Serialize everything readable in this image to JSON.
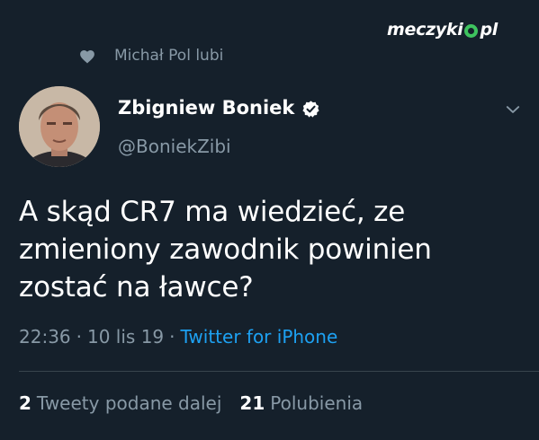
{
  "watermark": {
    "part1": "meczyki",
    "part2": "pl"
  },
  "social_context": {
    "icon": "heart-icon",
    "text": "Michał Pol lubi"
  },
  "author": {
    "name": "Zbigniew Boniek",
    "handle": "@BoniekZibi",
    "verified": true
  },
  "tweet": {
    "lines": [
      "A skąd CR7 ma wiedzieć, ze",
      "zmieniony zawodnik powinien",
      "zostać na ławce?"
    ],
    "time": "22:36",
    "date": "10 lis 19",
    "separator": "·",
    "source": "Twitter for iPhone"
  },
  "stats": {
    "retweets_count": "2",
    "retweets_label": "Tweety podane dalej",
    "likes_count": "21",
    "likes_label": "Polubienia"
  },
  "colors": {
    "background": "#15202b",
    "secondary_text": "#8899a6",
    "link": "#1da1f2",
    "verified_badge": "#ffffff",
    "divider": "#38444d"
  }
}
